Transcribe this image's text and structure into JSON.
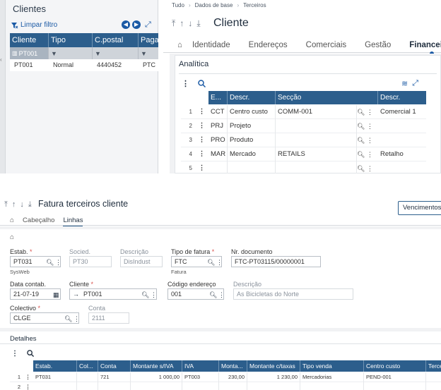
{
  "left_panel": {
    "title": "Clientes",
    "clear_filter": "Limpar filtro",
    "columns": [
      "Cliente",
      "Tipo",
      "C.postal",
      "Paga"
    ],
    "filter_value": "PT001",
    "rows": [
      {
        "cliente": "PT001",
        "tipo": "Normal",
        "cpostal": "4440452",
        "paga": "PTC"
      }
    ]
  },
  "breadcrumb": [
    "Tudo",
    "Dados de base",
    "Terceiros"
  ],
  "cliente_panel": {
    "title": "Cliente",
    "tabs": [
      "Identidade",
      "Endereços",
      "Comerciais",
      "Gestão",
      "Financeiras"
    ],
    "active_tab": "Financeiras",
    "section_title": "Analítica",
    "columns": [
      "E...",
      "Descr.",
      "Secção",
      "Descr."
    ],
    "rows": [
      {
        "n": "1",
        "e": "CCT",
        "descr": "Centro custo",
        "seccao": "COMM-001",
        "descr2": "Comercial 1"
      },
      {
        "n": "2",
        "e": "PRJ",
        "descr": "Projeto",
        "seccao": "",
        "descr2": ""
      },
      {
        "n": "3",
        "e": "PRO",
        "descr": "Produto",
        "seccao": "",
        "descr2": ""
      },
      {
        "n": "4",
        "e": "MAR",
        "descr": "Mercado",
        "seccao": "RETAILS",
        "descr2": "Retalho"
      },
      {
        "n": "5",
        "e": "",
        "descr": "",
        "seccao": "",
        "descr2": ""
      }
    ]
  },
  "fatura": {
    "title": "Fatura terceiros cliente",
    "button_vencimentos": "Vencimentos",
    "tabs": [
      "Cabeçalho",
      "Linhas"
    ],
    "active_tab": "Linhas",
    "fields": {
      "estab_label": "Estab.",
      "estab_value": "PT031",
      "estab_sub": "SysWeb",
      "socied_label": "Socied.",
      "socied_value": "PT30",
      "descricao_label": "Descrição",
      "descricao_value": "DisIndust",
      "tipo_fatura_label": "Tipo de fatura",
      "tipo_fatura_value": "FTC",
      "tipo_fatura_sub": "Fatura",
      "nr_doc_label": "Nr. documento",
      "nr_doc_value": "FTC-PT03115/00000001",
      "data_label": "Data contab.",
      "data_value": "21-07-19",
      "cliente_label": "Cliente",
      "cliente_value": "PT001",
      "cod_end_label": "Código endereço",
      "cod_end_value": "001",
      "descricao2_label": "Descrição",
      "descricao2_value": "As Bicicletas do Norte",
      "colectivo_label": "Colectivo",
      "colectivo_value": "CLGE",
      "conta_label": "Conta",
      "conta_value": "2111"
    },
    "details_title": "Detalhes",
    "detail_columns": [
      "Estab.",
      "Col...",
      "Conta",
      "Montante s/IVA",
      "IVA",
      "Monta...",
      "Montante c/taxas",
      "Tipo venda",
      "Centro custo",
      "Terce"
    ],
    "detail_rows": [
      {
        "n": "1",
        "estab": "PT031",
        "col": "",
        "conta": "721",
        "mont": "1 000,00",
        "iva": "PT003",
        "monta": "230,00",
        "montc": "1 230,00",
        "tipo": "Mercadorias",
        "cc": "PEND-001"
      },
      {
        "n": "2",
        "estab": "",
        "col": "",
        "conta": "",
        "mont": "",
        "iva": "",
        "monta": "",
        "montc": "",
        "tipo": "",
        "cc": ""
      }
    ]
  }
}
